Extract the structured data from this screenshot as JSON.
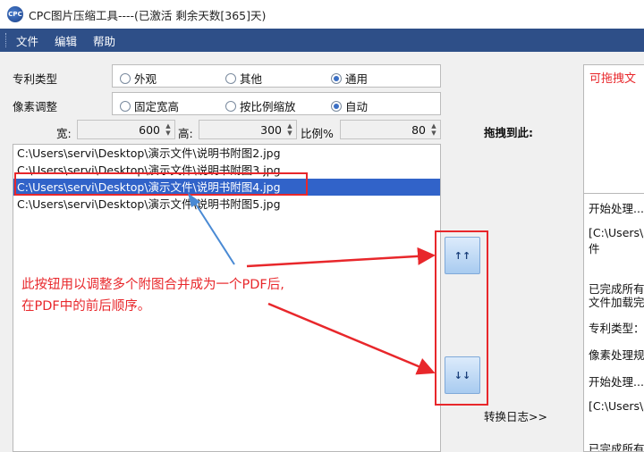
{
  "window": {
    "title": "CPC图片压缩工具----(已激活 剩余天数[365]天)"
  },
  "menu": [
    "文件",
    "编辑",
    "帮助"
  ],
  "patent_type": {
    "label": "专利类型",
    "options": [
      {
        "label": "外观",
        "checked": false
      },
      {
        "label": "其他",
        "checked": false
      },
      {
        "label": "通用",
        "checked": true
      }
    ]
  },
  "pixel_adjust": {
    "label": "像素调整",
    "options": [
      {
        "label": "固定宽高",
        "checked": false
      },
      {
        "label": "按比例缩放",
        "checked": false
      },
      {
        "label": "自动",
        "checked": true
      }
    ]
  },
  "size": {
    "width_label": "宽:",
    "width_value": "600",
    "height_label": "高:",
    "height_value": "300",
    "ratio_label": "比例%",
    "ratio_value": "80"
  },
  "files": [
    "C:\\Users\\servi\\Desktop\\演示文件\\说明书附图2.jpg",
    "C:\\Users\\servi\\Desktop\\演示文件\\说明书附图3.jpg",
    "C:\\Users\\servi\\Desktop\\演示文件\\说明书附图4.jpg",
    "C:\\Users\\servi\\Desktop\\演示文件\\说明书附图5.jpg"
  ],
  "selected_file_index": 2,
  "buttons": {
    "up": "↑↑",
    "down": "↓↓"
  },
  "drop": {
    "label": "拖拽到此:",
    "hint": "可拖拽文"
  },
  "log": {
    "label": "转换日志>>",
    "lines": [
      "开始处理...",
      "[C:\\Users\\s",
      "件",
      "已完成所有",
      "文件加载完",
      "专利类型：",
      "像素处理规",
      "开始处理...",
      "[C:\\Users\\s",
      "已完成所有"
    ]
  },
  "annotation": {
    "line1": "此按钮用以调整多个附图合并成为一个PDF后,",
    "line2": "在PDF中的前后顺序。"
  },
  "colors": {
    "menubar": "#2e4f88",
    "selection": "#3163c9",
    "annotation": "#e8272b"
  }
}
